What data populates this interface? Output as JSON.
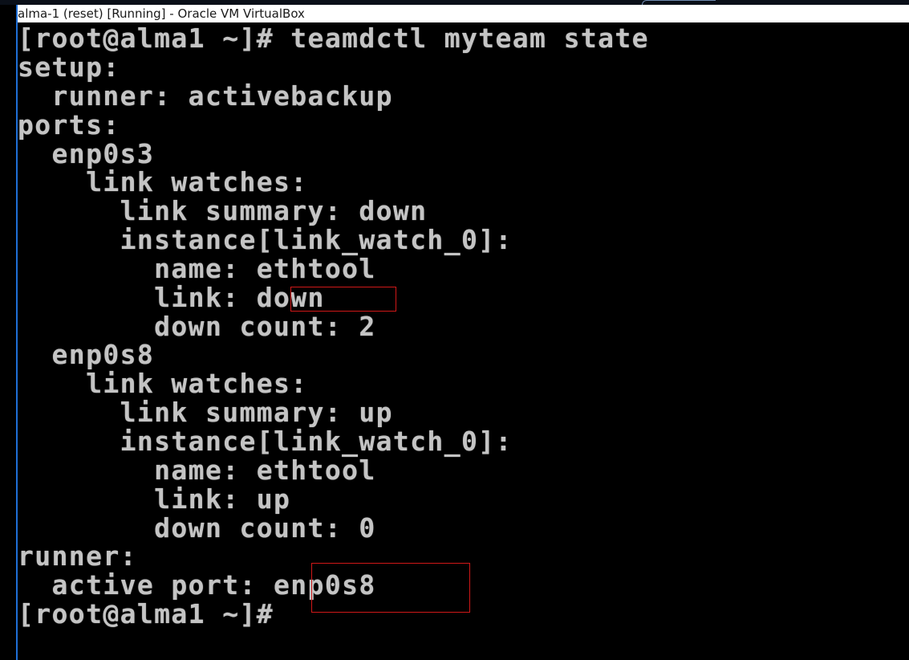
{
  "window": {
    "title": "alma-1 (reset) [Running] - Oracle VM VirtualBox"
  },
  "console": {
    "lines": [
      "[root@alma1 ~]# teamdctl myteam state",
      "setup:",
      "  runner: activebackup",
      "ports:",
      "  enp0s3",
      "    link watches:",
      "      link summary: down",
      "      instance[link_watch_0]:",
      "        name: ethtool",
      "        link: down",
      "        down count: 2",
      "  enp0s8",
      "    link watches:",
      "      link summary: up",
      "      instance[link_watch_0]:",
      "        name: ethtool",
      "        link: up",
      "        down count: 0",
      "runner:",
      "  active port: enp0s8",
      "[root@alma1 ~]#"
    ]
  },
  "highlights": {
    "color": "#d01818",
    "marked_values": [
      "down",
      "enp0s8"
    ]
  },
  "colors": {
    "terminal_background": "#000000",
    "terminal_text": "#c4c4c4",
    "window_border": "#1f6fd6"
  }
}
